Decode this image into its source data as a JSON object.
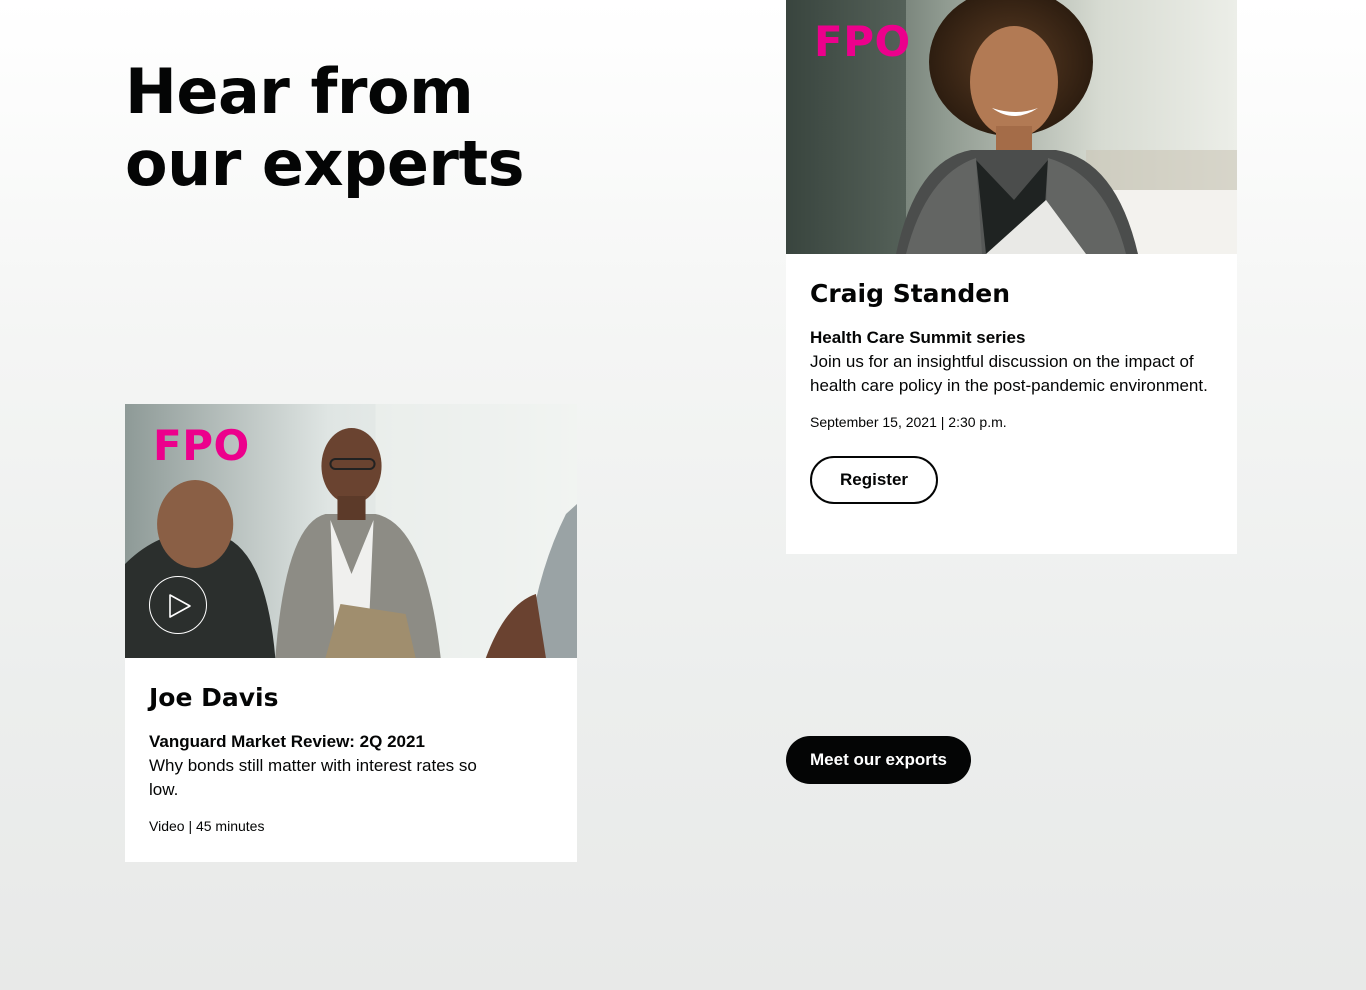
{
  "section": {
    "headline_line1": "Hear from",
    "headline_line2": "our experts"
  },
  "cards": [
    {
      "image_label": "FPO",
      "name": "Craig Standen",
      "event_title": "Health Care Summit series",
      "description": "Join us for an insightful discussion on the impact of health care policy in the post-pandemic environment.",
      "meta": "September 15, 2021 | 2:30 p.m.",
      "button_label": "Register"
    },
    {
      "image_label": "FPO",
      "name": "Joe Davis",
      "event_title": "Vanguard Market Review: 2Q 2021",
      "description": "Why bonds still matter with interest rates so low.",
      "meta": "Video | 45 minutes",
      "icon": "play-icon"
    }
  ],
  "cta": {
    "label": "Meet our exports"
  },
  "colors": {
    "accent_fpo": "#ec008c",
    "ink": "#040505",
    "card_bg": "#ffffff"
  }
}
